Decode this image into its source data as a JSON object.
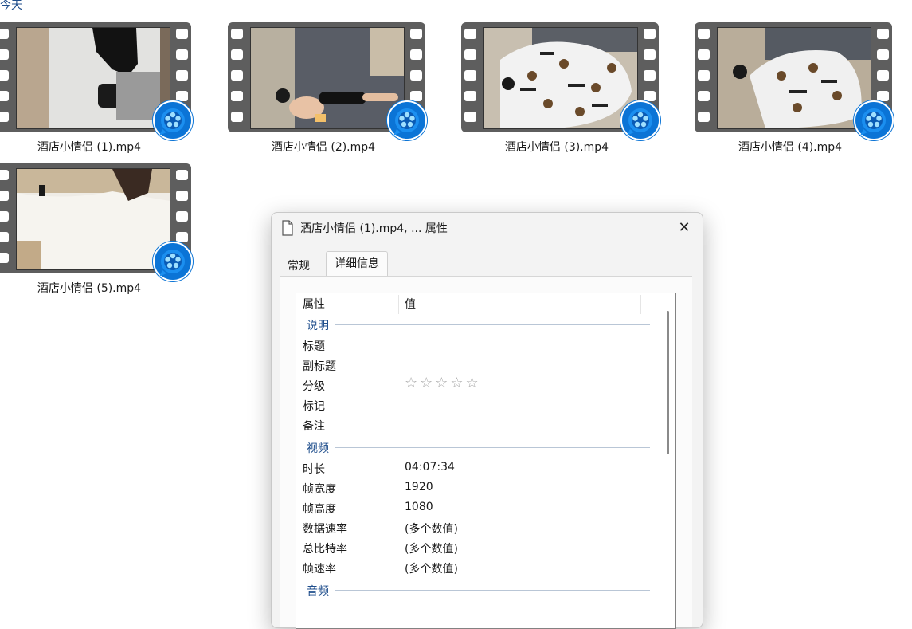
{
  "group_header": "今天",
  "files": [
    {
      "name": "酒店小情侣 (1).mp4"
    },
    {
      "name": "酒店小情侣 (2).mp4"
    },
    {
      "name": "酒店小情侣 (3).mp4"
    },
    {
      "name": "酒店小情侣 (4).mp4"
    },
    {
      "name": "酒店小情侣 (5).mp4"
    }
  ],
  "dialog": {
    "title": "酒店小情侣 (1).mp4, ... 属性",
    "close_glyph": "✕",
    "tabs": {
      "general": "常规",
      "details": "详细信息"
    },
    "columns": {
      "property": "属性",
      "value": "值"
    },
    "sections": {
      "description": "说明",
      "video": "视频",
      "audio": "音频"
    },
    "props": {
      "title": {
        "name": "标题",
        "value": ""
      },
      "subtitle": {
        "name": "副标题",
        "value": ""
      },
      "rating": {
        "name": "分级",
        "value": "☆☆☆☆☆"
      },
      "tags": {
        "name": "标记",
        "value": ""
      },
      "comments": {
        "name": "备注",
        "value": ""
      },
      "length": {
        "name": "时长",
        "value": "04:07:34"
      },
      "frame_width": {
        "name": "帧宽度",
        "value": "1920"
      },
      "frame_height": {
        "name": "帧高度",
        "value": "1080"
      },
      "data_rate": {
        "name": "数据速率",
        "value": "(多个数值)"
      },
      "total_bitrate": {
        "name": "总比特率",
        "value": "(多个数值)"
      },
      "frame_rate": {
        "name": "帧速率",
        "value": "(多个数值)"
      }
    }
  },
  "colors": {
    "accent": "#1f4e8c",
    "badge": "#0b74d6",
    "filmstrip": "#5e5e5e"
  },
  "icons": {
    "thumbnail_badge": "video-player-app-icon",
    "dialog_icon": "file-icon",
    "close": "close-icon"
  }
}
